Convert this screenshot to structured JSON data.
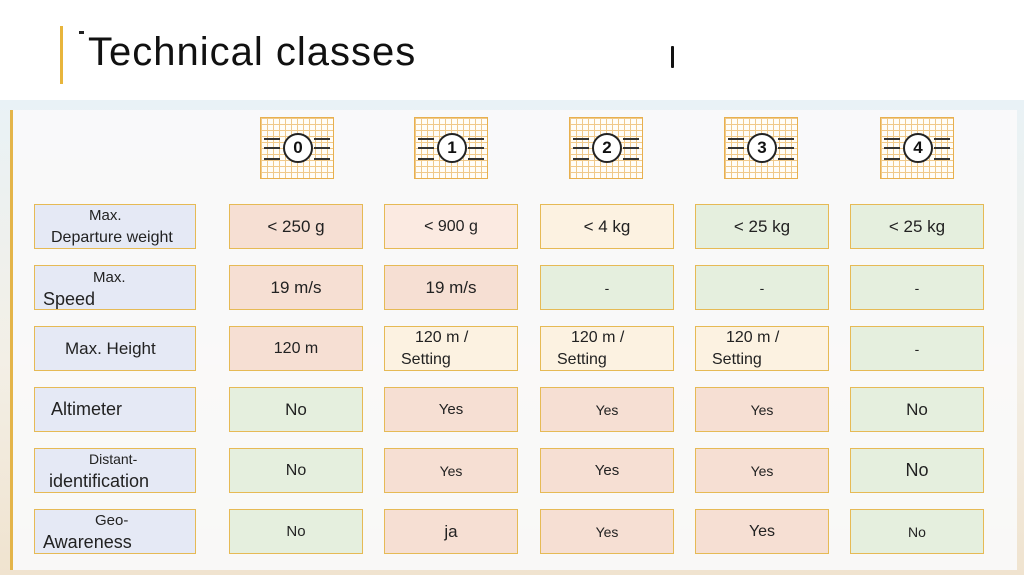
{
  "title": "Technical classes",
  "classes": [
    "0",
    "1",
    "2",
    "3",
    "4"
  ],
  "rows": [
    {
      "label_line1": "Max.",
      "label_line2": "Departure weight",
      "cells": [
        "< 250 g",
        "< 900 g",
        "< 4 kg",
        "< 25 kg",
        "< 25 kg"
      ]
    },
    {
      "label_line1": "Max.",
      "label_line2": "Speed",
      "cells": [
        "19 m/s",
        "19 m/s",
        "-",
        "-",
        "-"
      ]
    },
    {
      "label_line1": "",
      "label_line2": "Max. Height",
      "cells": [
        "120 m",
        "120 m / Setting",
        "120 m / Setting",
        "120 m / Setting",
        "-"
      ],
      "cells_line1": [
        "",
        "120 m /",
        "120 m /",
        "120 m /",
        ""
      ],
      "cells_line2": [
        "",
        "Setting",
        "Setting",
        "Setting",
        ""
      ]
    },
    {
      "label_line1": "",
      "label_line2": "Altimeter",
      "cells": [
        "No",
        "Yes",
        "Yes",
        "Yes",
        "No"
      ]
    },
    {
      "label_line1": "Distant-",
      "label_line2": "identification",
      "cells": [
        "No",
        "Yes",
        "Yes",
        "Yes",
        "No"
      ]
    },
    {
      "label_line1": "Geo-",
      "label_line2": "Awareness",
      "cells": [
        "No",
        "ja",
        "Yes",
        "Yes",
        "No"
      ]
    }
  ],
  "colors": {
    "accent": "#e8b53c",
    "pink": "#f6dfd3",
    "cream": "#fcf2e1",
    "green": "#e5efde",
    "label_bg": "#e5e9f5"
  }
}
